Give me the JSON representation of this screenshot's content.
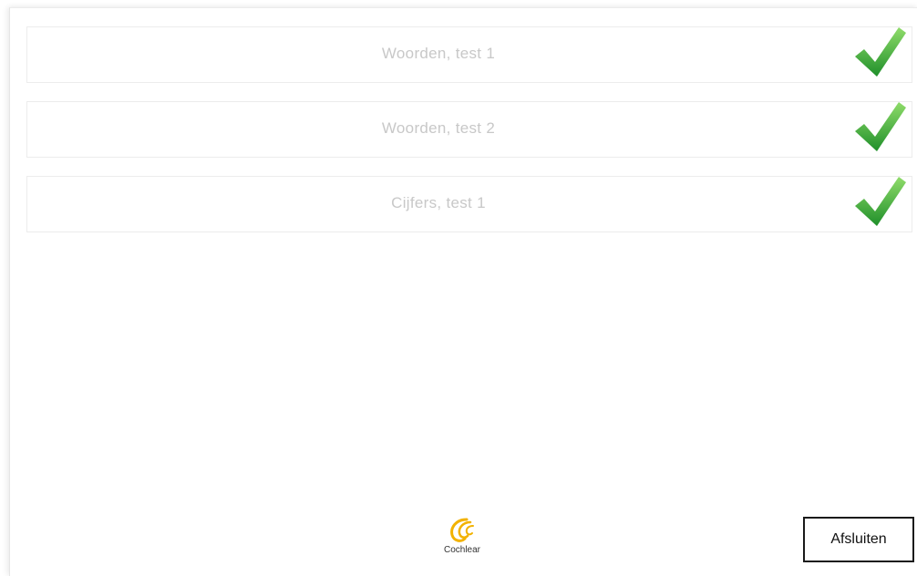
{
  "tests": [
    {
      "label": "Woorden, test 1",
      "completed": true,
      "icon": "checkmark-icon"
    },
    {
      "label": "Woorden, test 2",
      "completed": true,
      "icon": "checkmark-icon"
    },
    {
      "label": "Cijfers, test 1",
      "completed": true,
      "icon": "checkmark-icon"
    }
  ],
  "footer": {
    "brand": "Cochlear",
    "close_label": "Afsluiten"
  },
  "colors": {
    "check_green": "#34b233",
    "label_gray": "#c8c8c8",
    "brand_yellow": "#f2b200"
  }
}
